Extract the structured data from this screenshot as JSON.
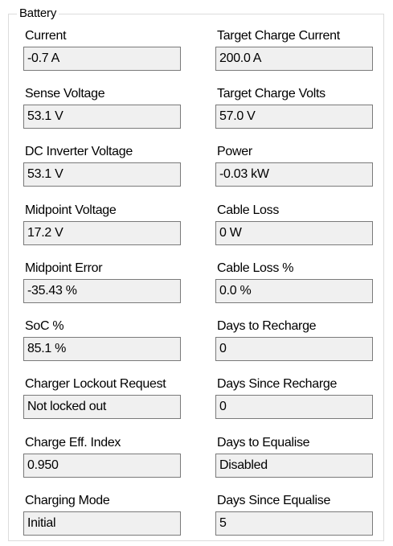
{
  "battery": {
    "title": "Battery",
    "fields": {
      "current": {
        "label": "Current",
        "value": "-0.7 A"
      },
      "target_charge_current": {
        "label": "Target Charge Current",
        "value": "200.0 A"
      },
      "sense_voltage": {
        "label": "Sense Voltage",
        "value": "53.1 V"
      },
      "target_charge_volts": {
        "label": "Target Charge Volts",
        "value": "57.0 V"
      },
      "dc_inverter_voltage": {
        "label": "DC Inverter Voltage",
        "value": "53.1 V"
      },
      "power": {
        "label": "Power",
        "value": "-0.03 kW"
      },
      "midpoint_voltage": {
        "label": "Midpoint Voltage",
        "value": "17.2 V"
      },
      "cable_loss": {
        "label": "Cable Loss",
        "value": "0 W"
      },
      "midpoint_error": {
        "label": "Midpoint Error",
        "value": "-35.43 %"
      },
      "cable_loss_pct": {
        "label": "Cable Loss %",
        "value": "0.0 %"
      },
      "soc_pct": {
        "label": "SoC %",
        "value": "85.1 %"
      },
      "days_to_recharge": {
        "label": "Days to Recharge",
        "value": "0"
      },
      "charger_lockout_request": {
        "label": "Charger Lockout Request",
        "value": "Not locked out"
      },
      "days_since_recharge": {
        "label": "Days Since Recharge",
        "value": "0"
      },
      "charge_eff_index": {
        "label": "Charge Eff. Index",
        "value": "0.950"
      },
      "days_to_equalise": {
        "label": "Days to Equalise",
        "value": "Disabled"
      },
      "charging_mode": {
        "label": "Charging Mode",
        "value": "Initial"
      },
      "days_since_equalise": {
        "label": "Days Since Equalise",
        "value": "5"
      }
    }
  }
}
